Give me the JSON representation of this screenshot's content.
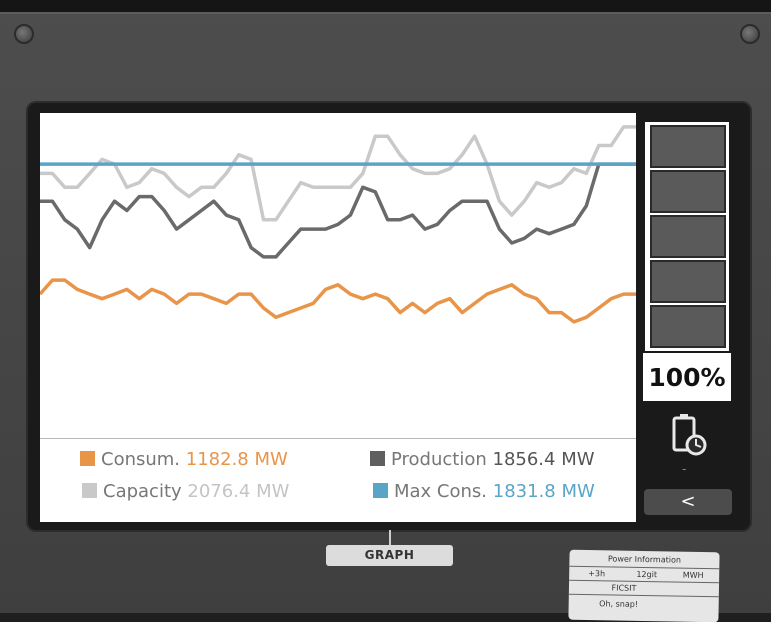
{
  "battery": {
    "percent_label": "100%",
    "level": 1.0,
    "status_text": "-"
  },
  "buttons": {
    "back_label": "<"
  },
  "tab": {
    "graph_label": "GRAPH"
  },
  "info_card": {
    "title": "Power Information",
    "columns": [
      "+3h",
      "12git",
      "MWH"
    ],
    "row2": "FICSIT",
    "row3": "Oh, snap!"
  },
  "legend": {
    "consumption": {
      "label": "Consum.",
      "value": "1182.8 MW",
      "color": "#e8954a"
    },
    "production": {
      "label": "Production",
      "value": "1856.4 MW",
      "color": "#6a6a6a"
    },
    "capacity": {
      "label": "Capacity",
      "value": "2076.4 MW",
      "color": "#c9c9c9"
    },
    "max_consumption": {
      "label": "Max Cons.",
      "value": "1831.8 MW",
      "color": "#5aa5c7"
    }
  },
  "chart_data": {
    "type": "line",
    "series": [
      {
        "name": "Capacity",
        "color": "#c9c9c9",
        "values": [
          2020,
          2020,
          1990,
          1990,
          2020,
          2050,
          2040,
          1990,
          2000,
          2030,
          2020,
          1990,
          1970,
          1990,
          1990,
          2020,
          2060,
          2050,
          1920,
          1920,
          1960,
          2000,
          1990,
          1990,
          1990,
          1990,
          2020,
          2100,
          2100,
          2060,
          2030,
          2020,
          2020,
          2030,
          2060,
          2100,
          2040,
          1960,
          1930,
          1960,
          2000,
          1990,
          2000,
          2030,
          2020,
          2080,
          2080,
          2120,
          2120
        ]
      },
      {
        "name": "Production",
        "color": "#6a6a6a",
        "values": [
          1960,
          1960,
          1920,
          1900,
          1860,
          1920,
          1960,
          1940,
          1970,
          1970,
          1940,
          1900,
          1920,
          1940,
          1960,
          1930,
          1920,
          1860,
          1840,
          1840,
          1870,
          1900,
          1900,
          1900,
          1910,
          1930,
          1990,
          1980,
          1920,
          1920,
          1930,
          1900,
          1910,
          1940,
          1960,
          1960,
          1960,
          1900,
          1870,
          1880,
          1900,
          1890,
          1900,
          1910,
          1950,
          2040,
          2040,
          2040,
          2040
        ]
      },
      {
        "name": "Max Cons.",
        "color": "#5aa5c7",
        "values": [
          2040,
          2040,
          2040,
          2040,
          2040,
          2040,
          2040,
          2040,
          2040,
          2040,
          2040,
          2040,
          2040,
          2040,
          2040,
          2040,
          2040,
          2040,
          2040,
          2040,
          2040,
          2040,
          2040,
          2040,
          2040,
          2040,
          2040,
          2040,
          2040,
          2040,
          2040,
          2040,
          2040,
          2040,
          2040,
          2040,
          2040,
          2040,
          2040,
          2040,
          2040,
          2040,
          2040,
          2040,
          2040,
          2040,
          2040,
          2040,
          2040
        ]
      },
      {
        "name": "Consumption",
        "color": "#e8954a",
        "values": [
          1760,
          1790,
          1790,
          1770,
          1760,
          1750,
          1760,
          1770,
          1750,
          1770,
          1760,
          1740,
          1760,
          1760,
          1750,
          1740,
          1760,
          1760,
          1730,
          1710,
          1720,
          1730,
          1740,
          1770,
          1780,
          1760,
          1750,
          1760,
          1750,
          1720,
          1740,
          1720,
          1740,
          1750,
          1720,
          1740,
          1760,
          1770,
          1780,
          1760,
          1750,
          1720,
          1720,
          1700,
          1710,
          1730,
          1750,
          1760,
          1760
        ]
      }
    ],
    "ylim": [
      1450,
      2150
    ],
    "grid": false,
    "legend_position": "bottom"
  }
}
